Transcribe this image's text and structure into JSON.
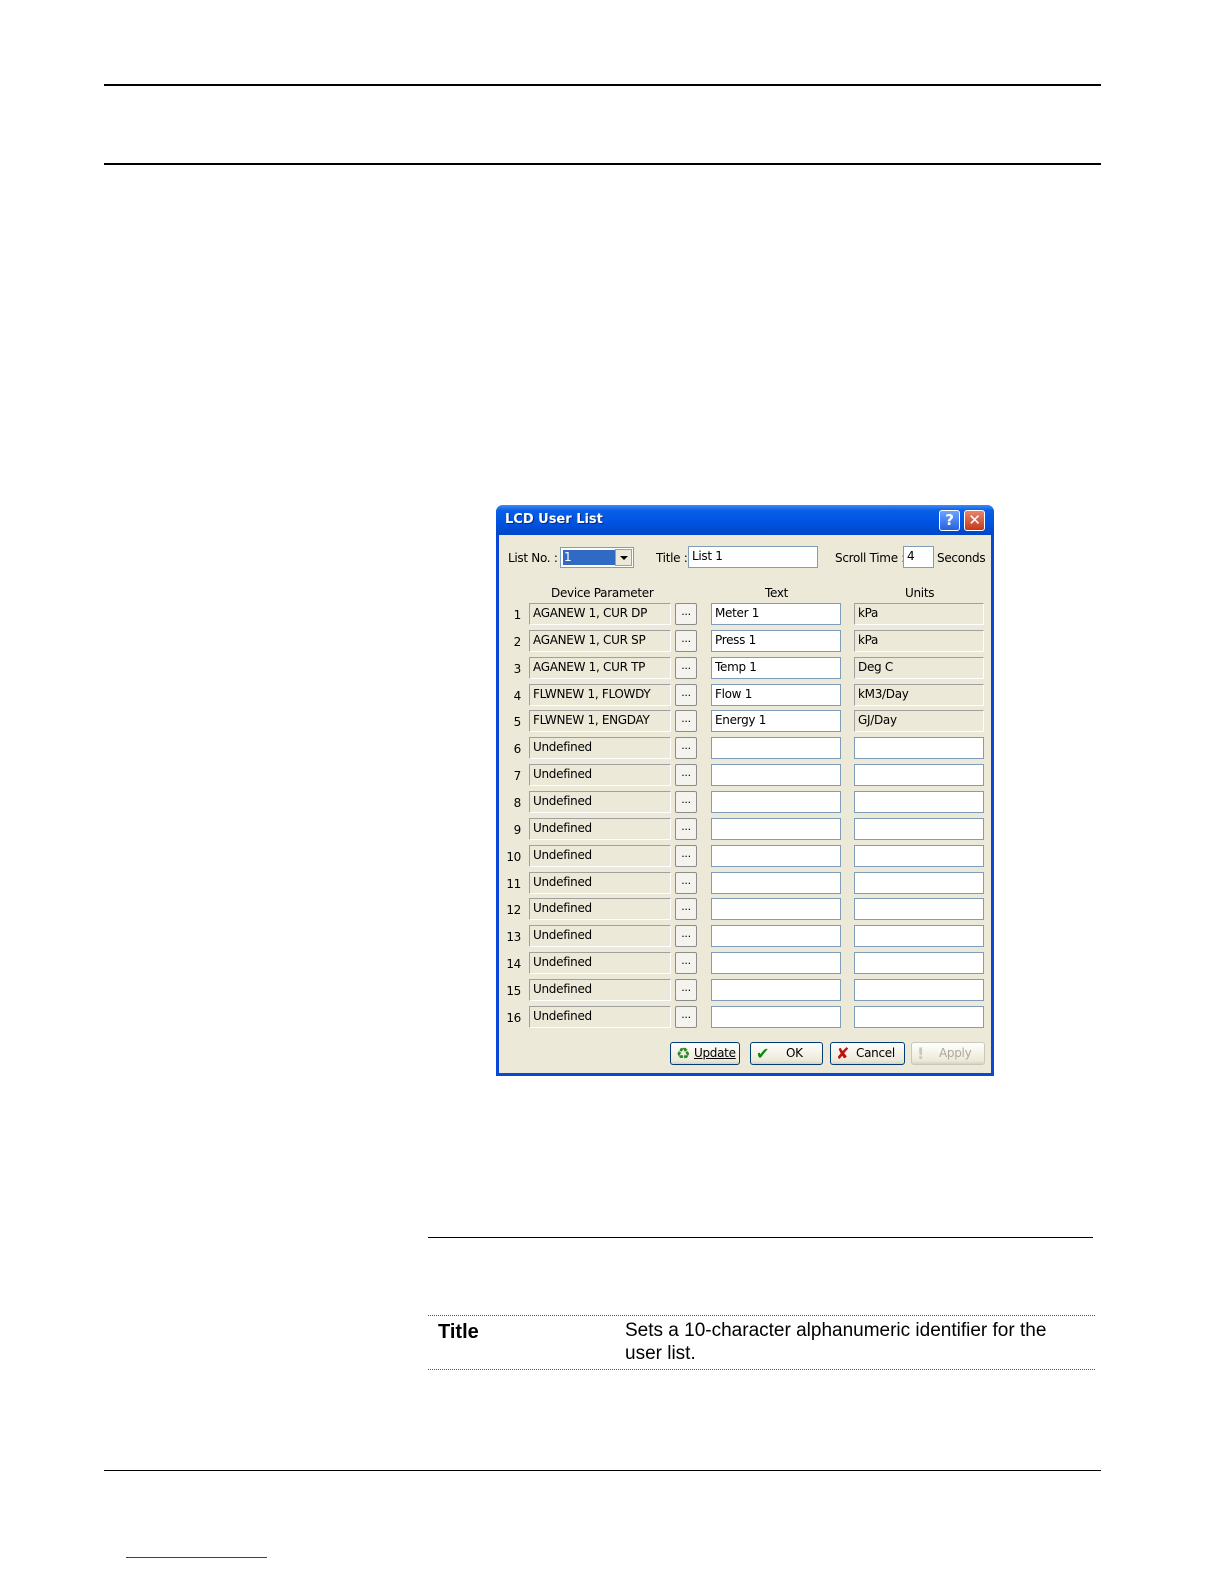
{
  "dialog": {
    "title": "LCD User List",
    "help_glyph": "?",
    "close_glyph": "✕",
    "list_no_label": "List No. :",
    "list_no_value": "1",
    "title_label": "Title :",
    "title_value": "List 1",
    "scroll_time_label": "Scroll Time :",
    "scroll_time_value": "4",
    "seconds_label": "Seconds",
    "col_device_parameter": "Device Parameter",
    "col_text": "Text",
    "col_units": "Units",
    "browse_label": "...",
    "rows": [
      {
        "num": "1",
        "param": "AGANEW 1, CUR DP",
        "text": "Meter 1",
        "units": "kPa"
      },
      {
        "num": "2",
        "param": "AGANEW 1, CUR SP",
        "text": "Press 1",
        "units": "kPa"
      },
      {
        "num": "3",
        "param": "AGANEW 1, CUR TP",
        "text": "Temp 1",
        "units": "Deg C"
      },
      {
        "num": "4",
        "param": "FLWNEW 1, FLOWDY",
        "text": "Flow 1",
        "units": "kM3/Day"
      },
      {
        "num": "5",
        "param": "FLWNEW 1, ENGDAY",
        "text": "Energy 1",
        "units": "GJ/Day"
      },
      {
        "num": "6",
        "param": "Undefined",
        "text": "",
        "units": ""
      },
      {
        "num": "7",
        "param": "Undefined",
        "text": "",
        "units": ""
      },
      {
        "num": "8",
        "param": "Undefined",
        "text": "",
        "units": ""
      },
      {
        "num": "9",
        "param": "Undefined",
        "text": "",
        "units": ""
      },
      {
        "num": "10",
        "param": "Undefined",
        "text": "",
        "units": ""
      },
      {
        "num": "11",
        "param": "Undefined",
        "text": "",
        "units": ""
      },
      {
        "num": "12",
        "param": "Undefined",
        "text": "",
        "units": ""
      },
      {
        "num": "13",
        "param": "Undefined",
        "text": "",
        "units": ""
      },
      {
        "num": "14",
        "param": "Undefined",
        "text": "",
        "units": ""
      },
      {
        "num": "15",
        "param": "Undefined",
        "text": "",
        "units": ""
      },
      {
        "num": "16",
        "param": "Undefined",
        "text": "",
        "units": ""
      }
    ],
    "buttons": {
      "update": "Update",
      "ok": "OK",
      "cancel": "Cancel",
      "apply": "Apply"
    }
  },
  "description": {
    "term": "Title",
    "text": "Sets a 10-character alphanumeric identifier for the user list."
  },
  "colors": {
    "titlebar": "#0054e3",
    "dialog_bg": "#ece9d8",
    "field_border": "#7f9db9"
  }
}
